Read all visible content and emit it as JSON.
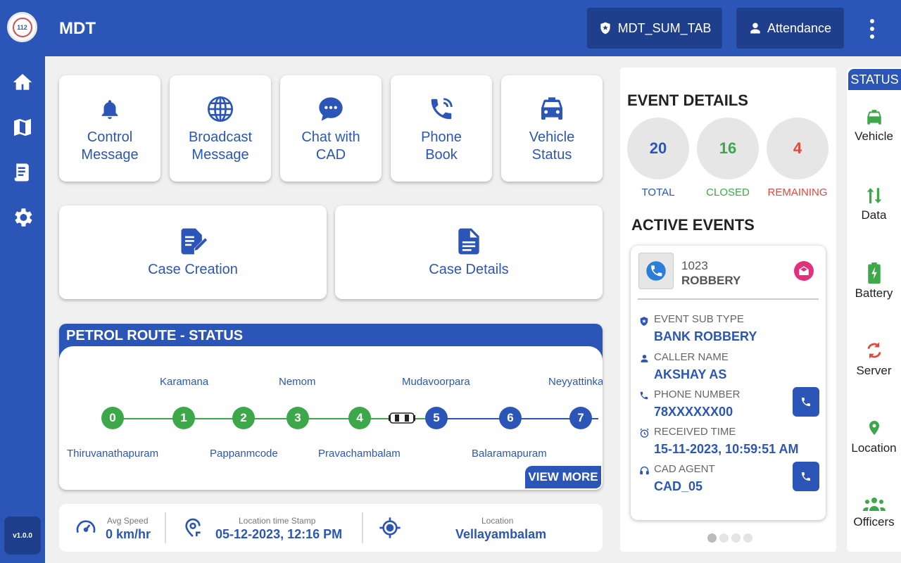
{
  "app": {
    "title": "MDT",
    "version": "v1.0.0",
    "logo_text": "112"
  },
  "rail": [
    {
      "icon": "home-icon"
    },
    {
      "icon": "map-icon"
    },
    {
      "icon": "receipt-icon"
    },
    {
      "icon": "gear-icon"
    }
  ],
  "topbar": {
    "device_label": "MDT_SUM_TAB",
    "attendance_label": "Attendance"
  },
  "tiles": [
    {
      "label": "Control\nMessage",
      "icon": "bell-icon"
    },
    {
      "label": "Broadcast\nMessage",
      "icon": "globe-icon"
    },
    {
      "label": "Chat with\nCAD",
      "icon": "chat-icon"
    },
    {
      "label": "Phone\nBook",
      "icon": "phone-ring-icon"
    },
    {
      "label": "Vehicle\nStatus",
      "icon": "taxi-icon"
    }
  ],
  "big_tiles": [
    {
      "label": "Case Creation",
      "icon": "edit-document-icon"
    },
    {
      "label": "Case Details",
      "icon": "document-icon"
    }
  ],
  "route": {
    "title": "PETROL ROUTE - STATUS",
    "view_more": "VIEW MORE",
    "stops": [
      {
        "num": "0",
        "name": "Thiruvanathapuram",
        "done": true
      },
      {
        "num": "1",
        "name": "Karamana",
        "done": true
      },
      {
        "num": "2",
        "name": "Pappanmcode",
        "done": true
      },
      {
        "num": "3",
        "name": "Nemom",
        "done": true
      },
      {
        "num": "4",
        "name": "Pravachambalam",
        "done": true
      },
      {
        "num": "5",
        "name": "Mudavoorpara",
        "done": false
      },
      {
        "num": "6",
        "name": "Balaramapuram",
        "done": false
      },
      {
        "num": "7",
        "name": "Neyyattinkara",
        "done": false
      }
    ]
  },
  "stats": {
    "avg_speed_caption": "Avg Speed",
    "avg_speed": "0 km/hr",
    "timestamp_caption": "Location time Stamp",
    "timestamp": "05-12-2023, 12:16 PM",
    "location_caption": "Location",
    "location": "Vellayambalam"
  },
  "events": {
    "title": "EVENT DETAILS",
    "total": "20",
    "total_label": "TOTAL",
    "closed": "16",
    "closed_label": "CLOSED",
    "remaining": "4",
    "remaining_label": "REMAINING",
    "active_title": "ACTIVE EVENTS",
    "card": {
      "id": "1023",
      "type": "ROBBERY",
      "sub_type_caption": "EVENT SUB TYPE",
      "sub_type": "BANK ROBBERY",
      "caller_caption": "CALLER NAME",
      "caller": "AKSHAY AS",
      "phone_caption": "PHONE NUMBER",
      "phone": "78XXXXXX00",
      "received_caption": "RECEIVED TIME",
      "received": "15-11-2023, 10:59:51 AM",
      "agent_caption": "CAD AGENT",
      "agent": "CAD_05"
    }
  },
  "status": {
    "title": "STATUS",
    "items": [
      {
        "label": "Vehicle",
        "icon": "car-icon",
        "color": "#3ca84a"
      },
      {
        "label": "Data",
        "icon": "data-arrows-icon",
        "color": "#3ca84a"
      },
      {
        "label": "Battery",
        "icon": "battery-icon",
        "color": "#3ca84a"
      },
      {
        "label": "Server",
        "icon": "sync-icon",
        "color": "#e2483b"
      },
      {
        "label": "Location",
        "icon": "location-pin-icon",
        "color": "#3ca84a"
      },
      {
        "label": "Officers",
        "icon": "group-icon",
        "color": "#3ca84a"
      }
    ]
  },
  "colors": {
    "primary": "#2b56b7",
    "dark": "#1f3f8c",
    "green": "#3ca84a",
    "red": "#e2483b",
    "pink": "#e2307a"
  }
}
